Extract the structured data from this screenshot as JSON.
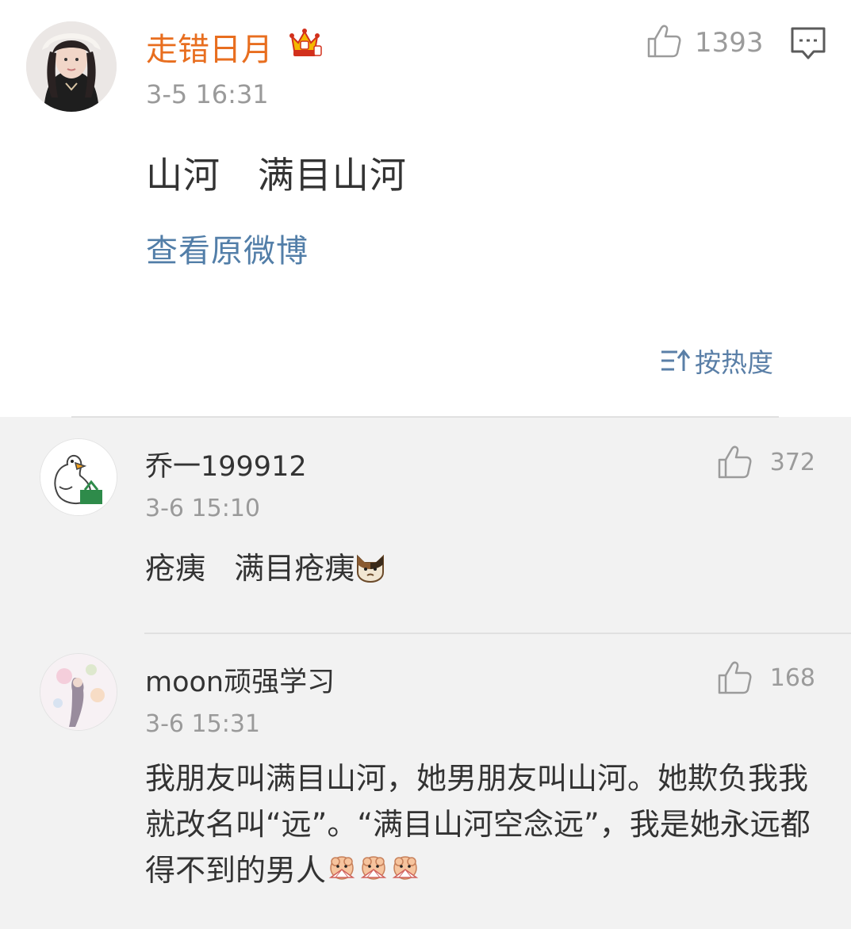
{
  "post": {
    "author": "走错日月",
    "time": "3-5 16:31",
    "text": "山河   满目山河",
    "view_original": "查看原微博",
    "likes": "1393"
  },
  "sort": {
    "label": "按热度"
  },
  "comments": [
    {
      "name": "乔一199912",
      "time": "3-6 15:10",
      "text": "疮痍   满目疮痍",
      "likes": "372"
    },
    {
      "name": "moon顽强学习",
      "time": "3-6 15:31",
      "text": "我朋友叫满目山河，她男朋友叫山河。她欺负我我就改名叫“远”。“满目山河空念远”，我是她永远都得不到的男人",
      "likes": "168"
    }
  ],
  "icons": {
    "crown": "crown-badge-icon",
    "like": "thumbs-up-icon",
    "comment": "comment-icon",
    "sort": "sort-icon",
    "cat_emoji": "cat-emoji-icon",
    "fan_emoji": "shy-fan-emoji-icon"
  },
  "colors": {
    "author": "#e86e1f",
    "link": "#527ea8",
    "secondary": "#9a9a9a",
    "comment_bg": "#f2f2f2"
  }
}
